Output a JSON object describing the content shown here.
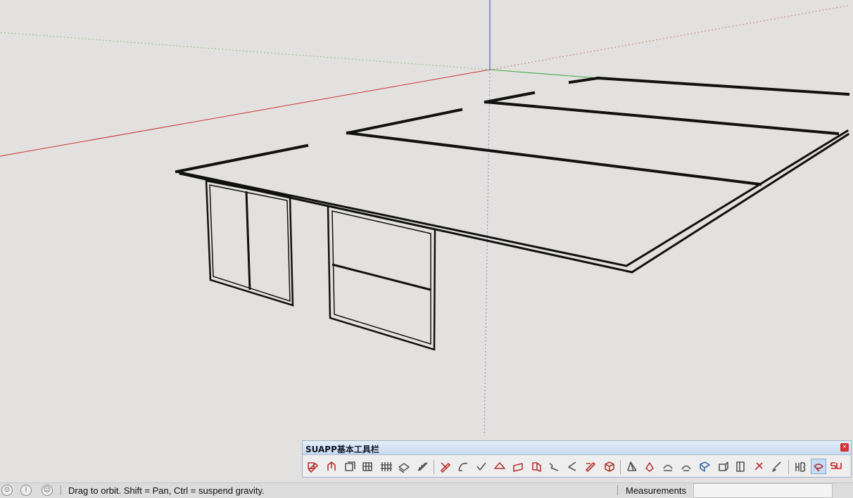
{
  "toolbar": {
    "title": "SUAPP基本工具栏",
    "close_label": "×",
    "buttons": [
      {
        "name": "tool-1",
        "icon": "pencil-box-icon",
        "color": "#b83232"
      },
      {
        "name": "tool-2",
        "icon": "push-pull-icon",
        "color": "#b83232"
      },
      {
        "name": "tool-3",
        "icon": "box-outline-icon",
        "color": "#555555"
      },
      {
        "name": "tool-4",
        "icon": "grid-icon",
        "color": "#555555"
      },
      {
        "name": "tool-5",
        "icon": "fence-icon",
        "color": "#555555"
      },
      {
        "name": "tool-6",
        "icon": "layer-icon",
        "color": "#555555"
      },
      {
        "name": "tool-7",
        "icon": "stairs-icon",
        "color": "#555555"
      },
      {
        "name": "tool-8",
        "icon": "pencil-icon",
        "color": "#b83232"
      },
      {
        "name": "tool-9",
        "icon": "arc-icon",
        "color": "#555555"
      },
      {
        "name": "tool-10",
        "icon": "check-icon",
        "color": "#555555"
      },
      {
        "name": "tool-11",
        "icon": "roof-icon",
        "color": "#b83232"
      },
      {
        "name": "tool-12",
        "icon": "face-icon",
        "color": "#b83232"
      },
      {
        "name": "tool-13",
        "icon": "extrude-icon",
        "color": "#b83232"
      },
      {
        "name": "tool-14",
        "icon": "curve-icon",
        "color": "#555555"
      },
      {
        "name": "tool-15",
        "icon": "angle-icon",
        "color": "#555555"
      },
      {
        "name": "tool-16",
        "icon": "edit-icon",
        "color": "#b83232"
      },
      {
        "name": "tool-17",
        "icon": "cube-icon",
        "color": "#b83232"
      },
      {
        "name": "tool-18",
        "icon": "trusses-icon",
        "color": "#555555"
      },
      {
        "name": "tool-19",
        "icon": "solid-icon",
        "color": "#b83232"
      },
      {
        "name": "tool-20",
        "icon": "bend-icon",
        "color": "#555555"
      },
      {
        "name": "tool-21",
        "icon": "round-icon",
        "color": "#555555"
      },
      {
        "name": "tool-22",
        "icon": "glass-icon",
        "color": "#3a6ea5"
      },
      {
        "name": "tool-23",
        "icon": "box-3d-icon",
        "color": "#555555"
      },
      {
        "name": "tool-24",
        "icon": "door-icon",
        "color": "#555555"
      },
      {
        "name": "tool-25",
        "icon": "cut-icon",
        "color": "#b83232"
      },
      {
        "name": "tool-26",
        "icon": "brush-icon",
        "color": "#555555"
      },
      {
        "name": "tool-27",
        "icon": "hb-icon",
        "color": "#555555"
      },
      {
        "name": "tool-28",
        "icon": "layers-active-icon",
        "color": "#b83232"
      },
      {
        "name": "tool-29",
        "icon": "su-logo-icon",
        "color": "#c22222"
      }
    ]
  },
  "status": {
    "message": "Drag to orbit. Shift = Pan, Ctrl = suspend gravity.",
    "icons": [
      "geo-location-icon",
      "info-icon",
      "user-icon"
    ]
  },
  "measurements": {
    "label": "Measurements",
    "value": ""
  },
  "colors": {
    "x_axis": "#cc3333",
    "y_axis": "#33aa33",
    "z_axis": "#3344cc",
    "toolbar_header": "#c9dbef",
    "viewport_bg": "#e2e1df"
  }
}
